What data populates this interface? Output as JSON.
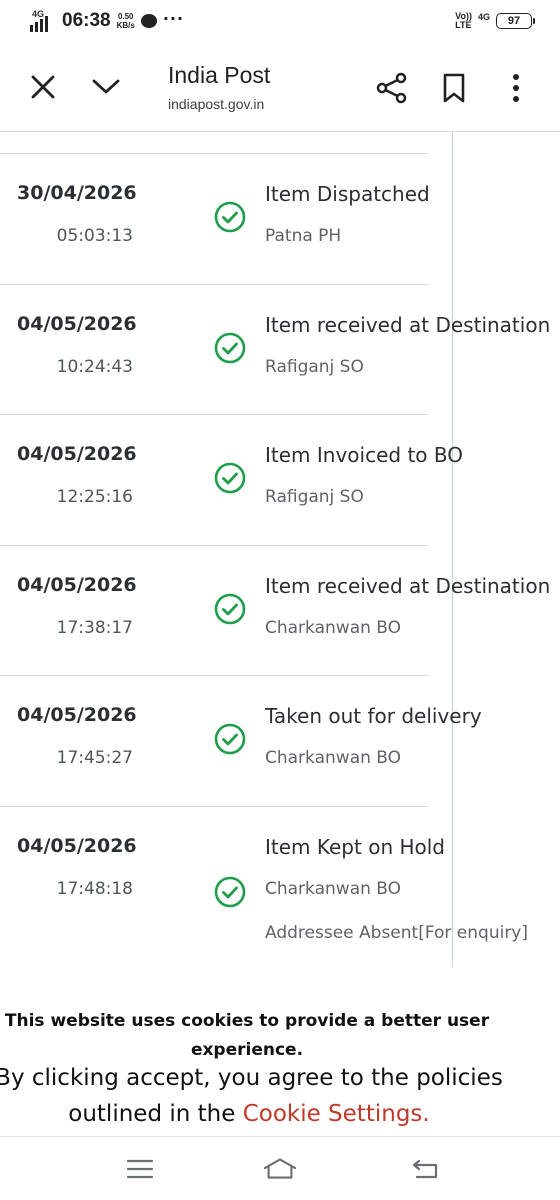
{
  "status_bar": {
    "network_tag": "4G",
    "time": "06:38",
    "speed_value": "0.50",
    "speed_unit": "KB/s",
    "volte": "Vo))",
    "lte": "LTE",
    "net_right": "4G",
    "battery": "97"
  },
  "browser": {
    "title": "India Post",
    "url": "indiapost.gov.in",
    "icons": [
      "close-icon",
      "chevron-down-icon",
      "share-icon",
      "bookmark-icon",
      "more-vertical-icon"
    ]
  },
  "tracking": [
    {
      "date": "30/04/2026",
      "time": "05:03:13",
      "status": "Item Dispatched",
      "office": "Patna PH"
    },
    {
      "date": "04/05/2026",
      "time": "10:24:43",
      "status": "Item received at Destination",
      "office": "Rafiganj SO"
    },
    {
      "date": "04/05/2026",
      "time": "12:25:16",
      "status": "Item Invoiced to BO",
      "office": "Rafiganj SO"
    },
    {
      "date": "04/05/2026",
      "time": "17:38:17",
      "status": "Item received at Destination",
      "office": "Charkanwan BO"
    },
    {
      "date": "04/05/2026",
      "time": "17:45:27",
      "status": "Taken out for delivery",
      "office": "Charkanwan BO"
    },
    {
      "date": "04/05/2026",
      "time": "17:48:18",
      "status": "Item Kept on Hold",
      "office": "Charkanwan BO",
      "remark": "Addressee Absent[For enquiry]"
    }
  ],
  "cookie": {
    "heading": "This website uses cookies to provide a better user experience.",
    "text": "By clicking accept, you agree to the policies outlined in the",
    "link": "Cookie Settings."
  },
  "colors": {
    "check": "#1e9e4a",
    "link": "#c0392b"
  },
  "nav_icons": [
    "menu-icon",
    "home-icon",
    "back-icon"
  ]
}
